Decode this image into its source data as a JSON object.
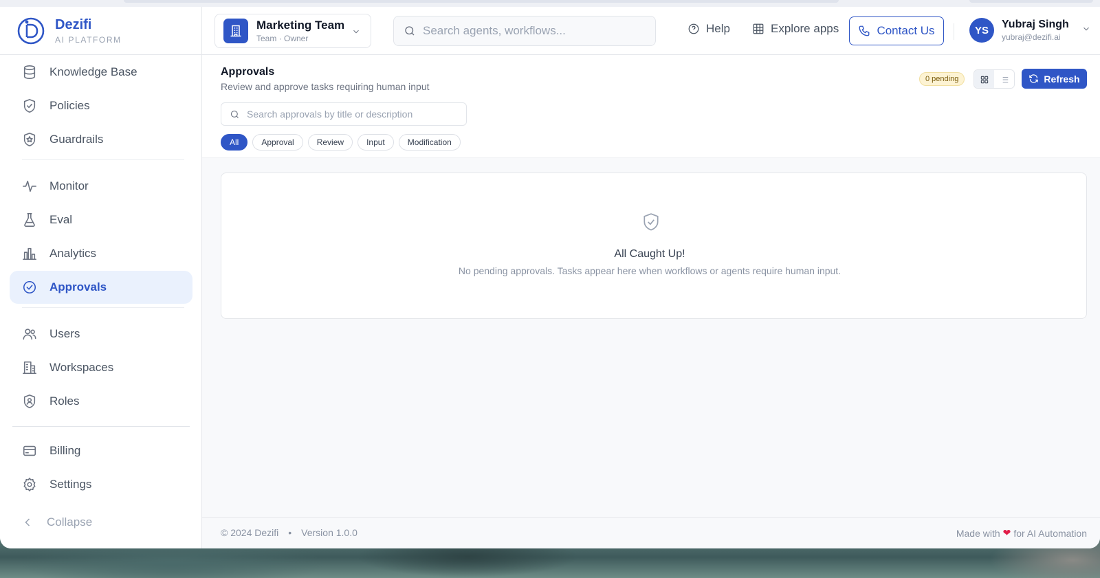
{
  "brand": {
    "name": "Dezifi",
    "tagline": "AI PLATFORM"
  },
  "sidebar": {
    "items": [
      {
        "label": "Knowledge Base",
        "icon": "database-icon"
      },
      {
        "label": "Policies",
        "icon": "shield-check-icon"
      },
      {
        "label": "Guardrails",
        "icon": "shield-star-icon"
      },
      {
        "label": "Monitor",
        "icon": "activity-icon"
      },
      {
        "label": "Eval",
        "icon": "flask-icon"
      },
      {
        "label": "Analytics",
        "icon": "bar-chart-icon"
      },
      {
        "label": "Approvals",
        "icon": "check-circle-icon",
        "active": true
      },
      {
        "label": "Users",
        "icon": "users-icon"
      },
      {
        "label": "Workspaces",
        "icon": "building-icon"
      },
      {
        "label": "Roles",
        "icon": "shield-user-icon"
      },
      {
        "label": "Billing",
        "icon": "credit-card-icon"
      },
      {
        "label": "Settings",
        "icon": "gear-icon"
      }
    ],
    "collapse_label": "Collapse"
  },
  "header": {
    "team": {
      "name": "Marketing Team",
      "meta": "Team · Owner"
    },
    "search_placeholder": "Search agents, workflows...",
    "help_label": "Help",
    "explore_label": "Explore apps",
    "contact_label": "Contact Us",
    "user": {
      "initials": "YS",
      "name": "Yubraj Singh",
      "email": "yubraj@dezifi.ai"
    }
  },
  "page": {
    "title": "Approvals",
    "subtitle": "Review and approve tasks requiring human input",
    "search_placeholder": "Search approvals by title or description",
    "filters": [
      "All",
      "Approval",
      "Review",
      "Input",
      "Modification"
    ],
    "active_filter": "All",
    "pending_badge": "0 pending",
    "refresh_label": "Refresh",
    "empty": {
      "title": "All Caught Up!",
      "text": "No pending approvals. Tasks appear here when workflows or agents require human input."
    }
  },
  "footer": {
    "copyright": "© 2024 Dezifi",
    "separator": "•",
    "version": "Version 1.0.0",
    "made_with_prefix": "Made with",
    "heart": "❤",
    "made_with_suffix": "for AI Automation"
  },
  "colors": {
    "accent": "#2f56c6",
    "active_bg": "#eaf1fd",
    "badge_bg": "#fdf3d3",
    "heart": "#e11d48"
  }
}
